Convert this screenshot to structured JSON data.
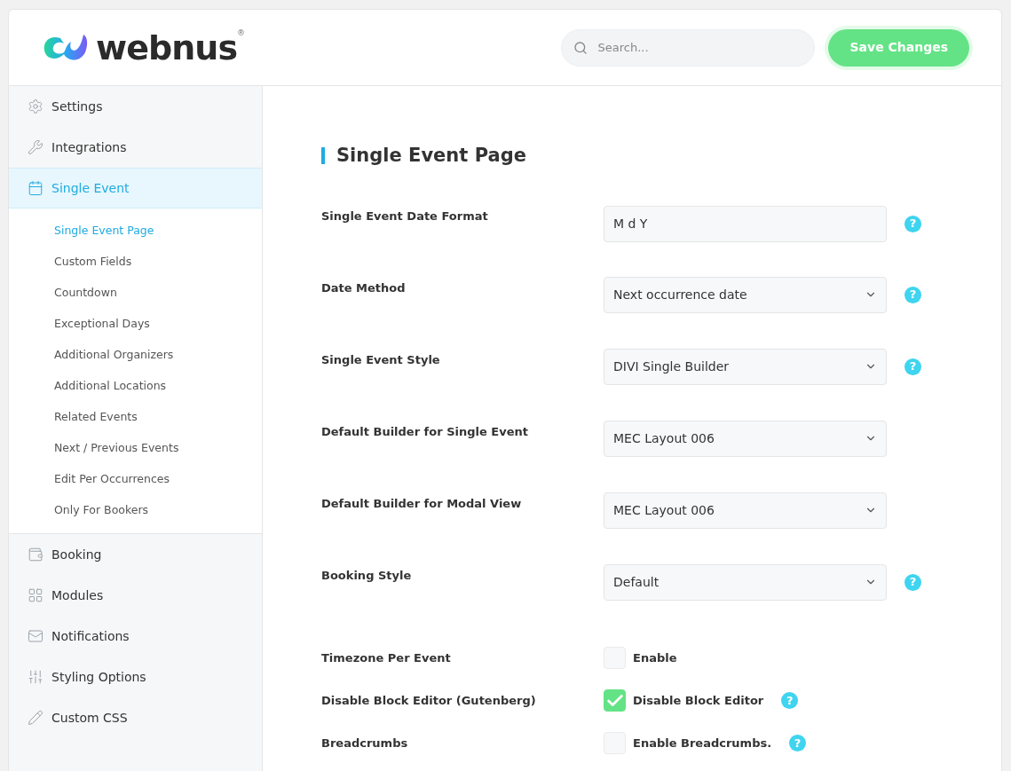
{
  "header": {
    "logo_text": "webnus",
    "logo_mark": "®",
    "search": {
      "placeholder": "Search..."
    },
    "save_button": "Save Changes"
  },
  "sidebar": {
    "items": [
      {
        "label": "Settings",
        "selected": false
      },
      {
        "label": "Integrations",
        "selected": false
      },
      {
        "label": "Single Event",
        "selected": true,
        "children": [
          {
            "label": "Single Event Page",
            "selected": true
          },
          {
            "label": "Custom Fields",
            "selected": false
          },
          {
            "label": "Countdown",
            "selected": false
          },
          {
            "label": "Exceptional Days",
            "selected": false
          },
          {
            "label": "Additional Organizers",
            "selected": false
          },
          {
            "label": "Additional Locations",
            "selected": false
          },
          {
            "label": "Related Events",
            "selected": false
          },
          {
            "label": "Next / Previous Events",
            "selected": false
          },
          {
            "label": "Edit Per Occurrences",
            "selected": false
          },
          {
            "label": "Only For Bookers",
            "selected": false
          }
        ]
      },
      {
        "label": "Booking",
        "selected": false
      },
      {
        "label": "Modules",
        "selected": false
      },
      {
        "label": "Notifications",
        "selected": false
      },
      {
        "label": "Styling Options",
        "selected": false
      },
      {
        "label": "Custom CSS",
        "selected": false
      }
    ]
  },
  "section_title": "Single Event Page",
  "fields": [
    {
      "kind": "text",
      "label": "Single Event Date Format",
      "value": "M d Y",
      "help": "?"
    },
    {
      "kind": "select",
      "label": "Date Method",
      "value": "Next occurrence date",
      "help": "?"
    },
    {
      "kind": "select",
      "label": "Single Event Style",
      "value": "DIVI Single Builder",
      "help": "?"
    },
    {
      "kind": "select",
      "label": "Default Builder for Single Event",
      "value": "MEC Layout 006"
    },
    {
      "kind": "select",
      "label": "Default Builder for Modal View",
      "value": "MEC Layout 006"
    },
    {
      "kind": "select",
      "label": "Booking Style",
      "value": "Default",
      "help": "?"
    },
    {
      "kind": "checkbox",
      "label": "Timezone Per Event",
      "option": "Enable",
      "checked": false
    },
    {
      "kind": "checkbox",
      "label": "Disable Block Editor (Gutenberg)",
      "option": "Disable Block Editor",
      "checked": true,
      "help": "?"
    },
    {
      "kind": "checkbox",
      "label": "Breadcrumbs",
      "option": "Enable Breadcrumbs.",
      "checked": false,
      "help": "?"
    }
  ]
}
